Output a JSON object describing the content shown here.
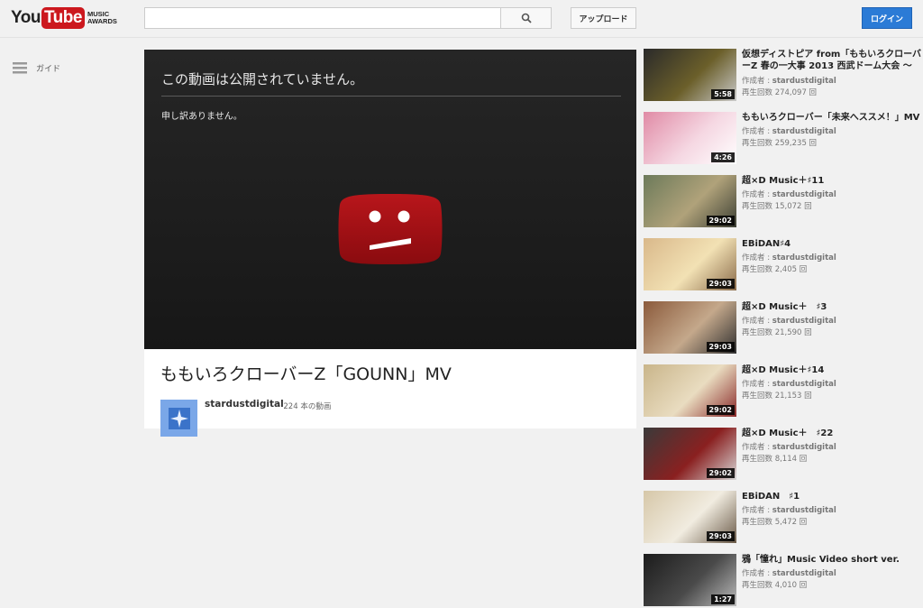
{
  "header": {
    "logo_you": "You",
    "logo_tube": "Tube",
    "logo_awards_line1": "MUSIC",
    "logo_awards_line2": "AWARDS",
    "search_icon": "search-icon",
    "upload_label": "アップロード",
    "login_label": "ログイン"
  },
  "guide": {
    "icon": "hamburger-icon",
    "label": "ガイド"
  },
  "player": {
    "title": "この動画は公開されていません。",
    "subtitle": "申し訳ありません。",
    "icon": "sad-face-icon"
  },
  "video": {
    "title": "ももいろクローバーZ「GOUNN」MV",
    "channel": "stardustdigital",
    "video_count": "· 224 本の動画"
  },
  "colors": {
    "accent": "#cc181e",
    "login": "#2b7bd6",
    "player_bg": "#1c1c1c"
  },
  "related": [
    {
      "title": "仮想ディストピア from「ももいろクローバ",
      "title2": "ーZ 春の一大事 2013 西武ドーム大会 〜",
      "author_prefix": "作成者 : ",
      "author": "stardustdigital",
      "views": "再生回数 274,097 回",
      "duration": "5:58"
    },
    {
      "title": "ももいろクローバー「未来へススメ！」MV",
      "title2": "",
      "author_prefix": "作成者 : ",
      "author": "stardustdigital",
      "views": "再生回数 259,235 回",
      "duration": "4:26"
    },
    {
      "title": "超×D Music＋♯11",
      "title2": "",
      "author_prefix": "作成者 : ",
      "author": "stardustdigital",
      "views": "再生回数 15,072 回",
      "duration": "29:02"
    },
    {
      "title": "EBiDAN♯4",
      "title2": "",
      "author_prefix": "作成者 : ",
      "author": "stardustdigital",
      "views": "再生回数 2,405 回",
      "duration": "29:03"
    },
    {
      "title": "超×D Music＋　♯3",
      "title2": "",
      "author_prefix": "作成者 : ",
      "author": "stardustdigital",
      "views": "再生回数 21,590 回",
      "duration": "29:03"
    },
    {
      "title": "超×D Music＋♯14",
      "title2": "",
      "author_prefix": "作成者 : ",
      "author": "stardustdigital",
      "views": "再生回数 21,153 回",
      "duration": "29:02"
    },
    {
      "title": "超×D Music＋　♯22",
      "title2": "",
      "author_prefix": "作成者 : ",
      "author": "stardustdigital",
      "views": "再生回数 8,114 回",
      "duration": "29:02"
    },
    {
      "title": "EBiDAN　♯1",
      "title2": "",
      "author_prefix": "作成者 : ",
      "author": "stardustdigital",
      "views": "再生回数 5,472 回",
      "duration": "29:03"
    },
    {
      "title": "鴉「憧れ」Music Video short ver.",
      "title2": "",
      "author_prefix": "作成者 : ",
      "author": "stardustdigital",
      "views": "再生回数 4,010 回",
      "duration": "1:27"
    }
  ]
}
